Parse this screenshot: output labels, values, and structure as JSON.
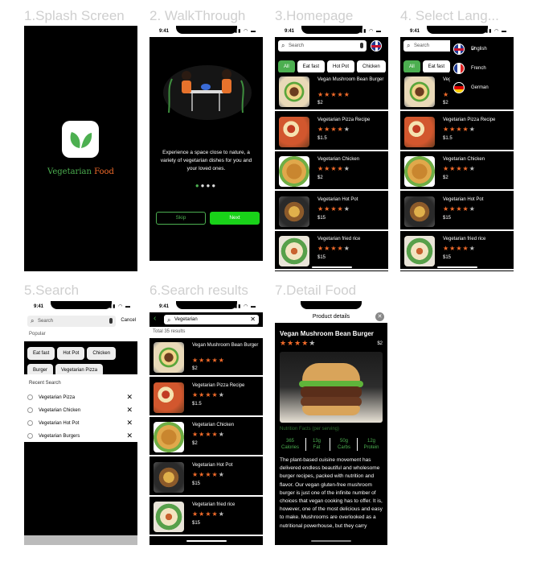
{
  "labels": {
    "s1": "1.Splash Screen",
    "s2": "2. WalkThrough",
    "s3": "3.Homepage",
    "s4": "4. Select Lang...",
    "s5": "5.Search",
    "s6": "6.Search results",
    "s7": "7.Detail Food"
  },
  "status_time": "9:41",
  "status_icons": "▮▮ ◠ ▬",
  "splash": {
    "brand_green": "Vegetarian",
    "brand_orange": "Food",
    "logo_icon": "leaf-icon"
  },
  "walkthrough": {
    "text": "Experience a space close to nature, a variety of vegetarian dishes for you and your loved ones.",
    "skip": "Skip",
    "next": "Next"
  },
  "home": {
    "search_placeholder": "Search",
    "chips": [
      "All",
      "Eat fast",
      "Hot Pot",
      "Chicken"
    ],
    "items": [
      {
        "title": "Vegan Mushroom Bean Burger",
        "stars": 5,
        "price": "$2",
        "img": "burger"
      },
      {
        "title": "Vegetarian Pizza Recipe",
        "stars": 4,
        "price": "$1.5",
        "img": "pizza"
      },
      {
        "title": "Vegetarian Chicken",
        "stars": 4,
        "price": "$2",
        "img": "chicken"
      },
      {
        "title": "Vegetarian Hot Pot",
        "stars": 4,
        "price": "$15",
        "img": "hotpot"
      },
      {
        "title": "Vegetarian fried rice",
        "stars": 4,
        "price": "$15",
        "img": "rice"
      }
    ]
  },
  "lang": {
    "options": [
      {
        "name": "English",
        "flag": "uk",
        "selected": true
      },
      {
        "name": "French",
        "flag": "fr",
        "selected": false
      },
      {
        "name": "German",
        "flag": "de",
        "selected": false
      }
    ]
  },
  "search": {
    "placeholder": "Search",
    "cancel": "Cancel",
    "popular_title": "Popular",
    "popular": [
      "Eat fast",
      "Hot Pot",
      "Chicken",
      "Burger",
      "Vegetarian Pizza"
    ],
    "recent_title": "Recent Search",
    "recent": [
      "Vegetarian Pizza",
      "Vegetarian Chicken",
      "Vegetarian Hot Pot",
      "Vegetarian Burgers"
    ]
  },
  "results": {
    "query": "Vegetarian",
    "total": "Total 35 results"
  },
  "detail": {
    "header": "Product details",
    "title": "Vegan Mushroom Bean Burger",
    "stars": 4,
    "price": "$2",
    "nutrition_title": "Nutrition Facts (per serving)",
    "nutrition": [
      {
        "value": "365",
        "label": "Calories"
      },
      {
        "value": "13g",
        "label": "Fat"
      },
      {
        "value": "50g",
        "label": "Carbs"
      },
      {
        "value": "12g",
        "label": "Protein"
      }
    ],
    "description": "The plant-based cuisine movement has delivered endless beautiful and wholesome burger recipes, packed with nutrition and flavor. Our vegan gluten-free mushroom burger is just one of the infinite number of choices that vegan cooking has to offer. It is, however, one of the most delicious and easy to make. Mushrooms are overlooked as a nutritional powerhouse, but they carry"
  },
  "colors": {
    "accent": "#4caf50",
    "star": "#f26b2a",
    "brand_orange": "#f26b2a",
    "bg": "#000000"
  }
}
